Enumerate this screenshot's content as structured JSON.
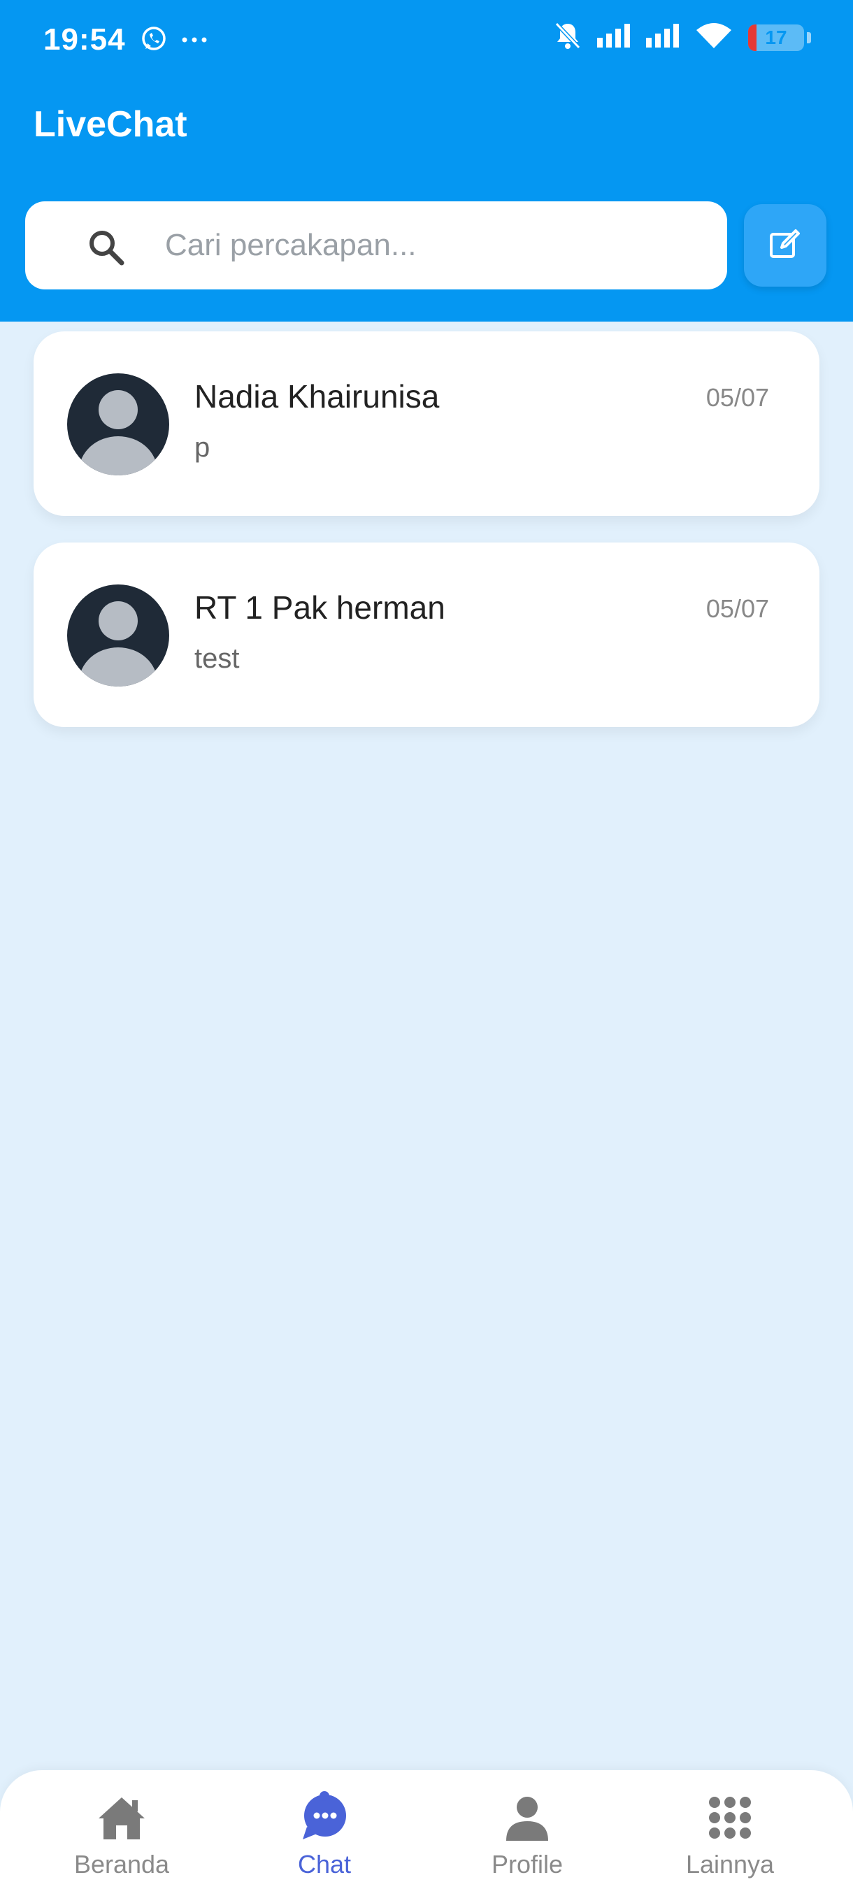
{
  "status_bar": {
    "time": "19:54",
    "battery_level": "17",
    "icons": [
      "whatsapp-icon",
      "more-dots-icon",
      "bell-off-icon",
      "signal-icon",
      "signal-icon",
      "wifi-icon",
      "battery-icon"
    ]
  },
  "header": {
    "title": "LiveChat",
    "background_color": "#0597F2"
  },
  "search": {
    "placeholder": "Cari percakapan..."
  },
  "chats": [
    {
      "name": "Nadia Khairunisa",
      "preview": "p",
      "date": "05/07"
    },
    {
      "name": "RT 1 Pak herman",
      "preview": "test",
      "date": "05/07"
    }
  ],
  "nav": {
    "items": [
      {
        "label": "Beranda",
        "icon": "home-icon",
        "active": false
      },
      {
        "label": "Chat",
        "icon": "chat-bubble-icon",
        "active": true
      },
      {
        "label": "Profile",
        "icon": "person-icon",
        "active": false
      },
      {
        "label": "Lainnya",
        "icon": "grid-dots-icon",
        "active": false
      }
    ],
    "active_color": "#4A63D8"
  }
}
